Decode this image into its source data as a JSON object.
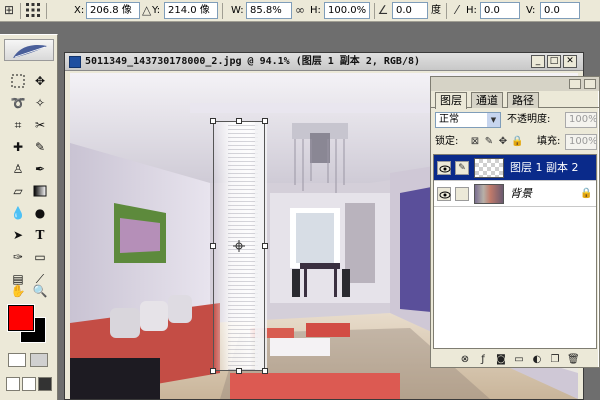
{
  "options_bar": {
    "x_label": "X:",
    "x_value": "206.8 像",
    "y_label": "Y:",
    "y_value": "214.0 像",
    "w_label": "W:",
    "w_value": "85.8%",
    "h_label": "H:",
    "h_value": "100.0%",
    "rotate_value": "0.0",
    "rotate_unit": "度",
    "skew_h_label": "H:",
    "skew_h_value": "0.0",
    "skew_v_label": "V:",
    "skew_v_value": "0.0"
  },
  "document": {
    "title": "5011349_143730178000_2.jpg @ 94.1% (图层 1 副本 2, RGB/8)"
  },
  "layers_panel": {
    "tabs": [
      {
        "label": "图层",
        "active": true
      },
      {
        "label": "通道",
        "active": false
      },
      {
        "label": "路径",
        "active": false
      }
    ],
    "blend_mode": "正常",
    "opacity_label": "不透明度:",
    "opacity_value": "100%",
    "lock_label": "锁定:",
    "fill_label": "填充:",
    "fill_value": "100%",
    "layers": [
      {
        "name": "图层 1 副本 2",
        "selected": true,
        "italic": false,
        "thumbnail": "transparent-checker"
      },
      {
        "name": "背景",
        "selected": false,
        "italic": true,
        "thumbnail": "room-photo",
        "locked": true
      }
    ]
  },
  "colors": {
    "foreground": "#ff0000",
    "background": "#000000",
    "selected_layer": "#0a2a8a"
  }
}
